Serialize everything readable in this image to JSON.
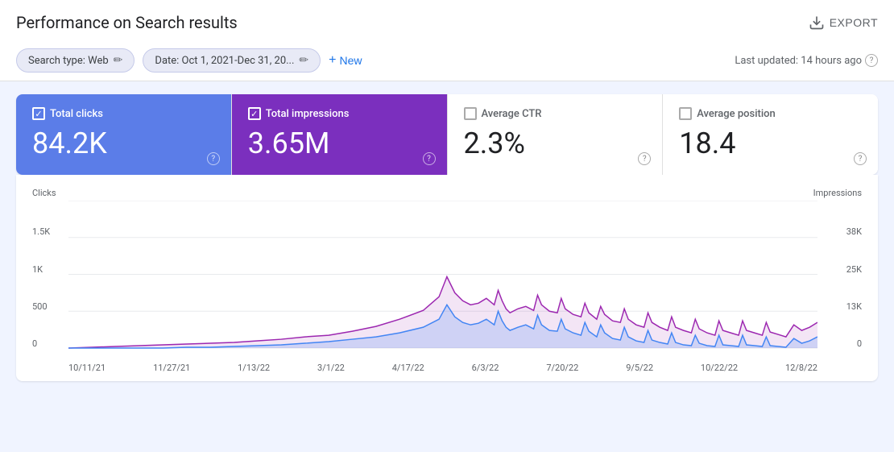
{
  "header": {
    "title": "Performance on Search results",
    "export_label": "EXPORT"
  },
  "filters": {
    "search_type_label": "Search type: Web",
    "date_label": "Date: Oct 1, 2021-Dec 31, 20...",
    "new_label": "New",
    "last_updated": "Last updated: 14 hours ago"
  },
  "metrics": [
    {
      "id": "total-clicks",
      "label": "Total clicks",
      "value": "84.2K",
      "active": true,
      "color": "blue"
    },
    {
      "id": "total-impressions",
      "label": "Total impressions",
      "value": "3.65M",
      "active": true,
      "color": "purple"
    },
    {
      "id": "average-ctr",
      "label": "Average CTR",
      "value": "2.3%",
      "active": false,
      "color": "none"
    },
    {
      "id": "average-position",
      "label": "Average position",
      "value": "18.4",
      "active": false,
      "color": "none"
    }
  ],
  "chart": {
    "y_left_title": "Clicks",
    "y_right_title": "Impressions",
    "y_left_labels": [
      "1.5K",
      "1K",
      "500",
      "0"
    ],
    "y_right_labels": [
      "38K",
      "25K",
      "13K",
      "0"
    ],
    "x_labels": [
      "10/11/21",
      "11/27/21",
      "1/13/22",
      "3/1/22",
      "4/17/22",
      "6/3/22",
      "7/20/22",
      "9/5/22",
      "10/22/22",
      "12/8/22"
    ],
    "colors": {
      "blue_line": "#4285f4",
      "purple_line": "#9c27b0",
      "blue_fill": "rgba(66,133,244,0.15)",
      "purple_fill": "rgba(156,39,176,0.1)"
    }
  },
  "icons": {
    "export": "⬇",
    "edit": "✏",
    "plus": "+",
    "help": "?",
    "check": "✓"
  }
}
